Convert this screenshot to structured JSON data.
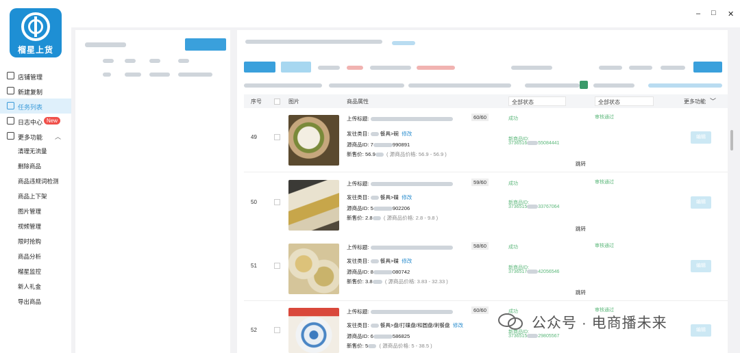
{
  "logo": {
    "text": "榴星上货"
  },
  "sidebar": {
    "items": [
      {
        "label": "店铺管理"
      },
      {
        "label": "新建复制"
      },
      {
        "label": "任务列表"
      },
      {
        "label": "日志中心",
        "badge": "New"
      },
      {
        "label": "更多功能"
      }
    ],
    "sub_items": [
      "清理无流量",
      "删除商品",
      "商品违规词检测",
      "商品上下架",
      "图片管理",
      "视频管理",
      "限时抢购",
      "商品分析",
      "榴星监控",
      "新人礼金",
      "导出商品"
    ]
  },
  "window": {
    "minimize": "–",
    "maximize": "□",
    "close": "✕"
  },
  "table": {
    "headers": {
      "seq": "序号",
      "pic": "图片",
      "attr": "商品属性",
      "state1": "全部状态",
      "state2": "全部状态",
      "more": "更多功能"
    },
    "rows": [
      {
        "seq": "49",
        "title_label": "上传标题:",
        "count": "60/60",
        "cat_label": "发往类目:",
        "cat": "餐具>碗",
        "edit": "修改",
        "src_label": "源商品ID:",
        "src_start": "7",
        "src_end": "990891",
        "price_label": "新售价:",
        "price": "56.9",
        "price_range": "( 源商品价格: 56.9 - 56.9 )",
        "status": "成功",
        "newid_label": "新商品ID:",
        "newid_start": "3736516",
        "newid_end": "55084441",
        "copy": "跳转",
        "audit": "审核通过",
        "op": "编辑"
      },
      {
        "seq": "50",
        "title_label": "上传标题:",
        "count": "59/60",
        "cat_label": "发往类目:",
        "cat": "餐具>碟",
        "edit": "修改",
        "src_label": "源商品ID:",
        "src_start": "5",
        "src_end": "902206",
        "price_label": "新售价:",
        "price": "2.8",
        "price_range": "( 源商品价格: 2.8 - 9.8 )",
        "status": "成功",
        "newid_label": "新商品ID:",
        "newid_start": "3736515",
        "newid_end": "33767064",
        "copy": "跳转",
        "audit": "审核通过",
        "op": "编辑"
      },
      {
        "seq": "51",
        "title_label": "上传标题:",
        "count": "58/60",
        "cat_label": "发往类目:",
        "cat": "餐具>碟",
        "edit": "修改",
        "src_label": "源商品ID:",
        "src_start": "8",
        "src_end": "080742",
        "price_label": "新售价:",
        "price": "3.8",
        "price_range": "( 源商品价格: 3.83 - 32.33 )",
        "status": "成功",
        "newid_label": "新商品ID:",
        "newid_start": "3736517",
        "newid_end": "42056546",
        "copy": "跳转",
        "audit": "审核通过",
        "op": "编辑"
      },
      {
        "seq": "52",
        "title_label": "上传标题:",
        "count": "60/60",
        "cat_label": "发往类目:",
        "cat": "餐具>盘/打碟盘/和圆盘/刺餐盘",
        "edit": "修改",
        "src_label": "源商品ID:",
        "src_start": "6",
        "src_end": "586825",
        "price_label": "新售价:",
        "price": "5",
        "price_range": "( 源商品价格: 5 - 38.5 )",
        "status": "成功",
        "newid_label": "新商品ID:",
        "newid_start": "3736515",
        "newid_end": "29805567",
        "copy": "",
        "audit": "审核通过",
        "op": "编辑"
      }
    ]
  },
  "watermark": {
    "text": "公众号 · 电商播未来"
  },
  "colors": {
    "accent": "#2e8fcf",
    "success": "#5bb77a",
    "badge": "#f0504a",
    "logo_bg": "#1e8fd4"
  }
}
